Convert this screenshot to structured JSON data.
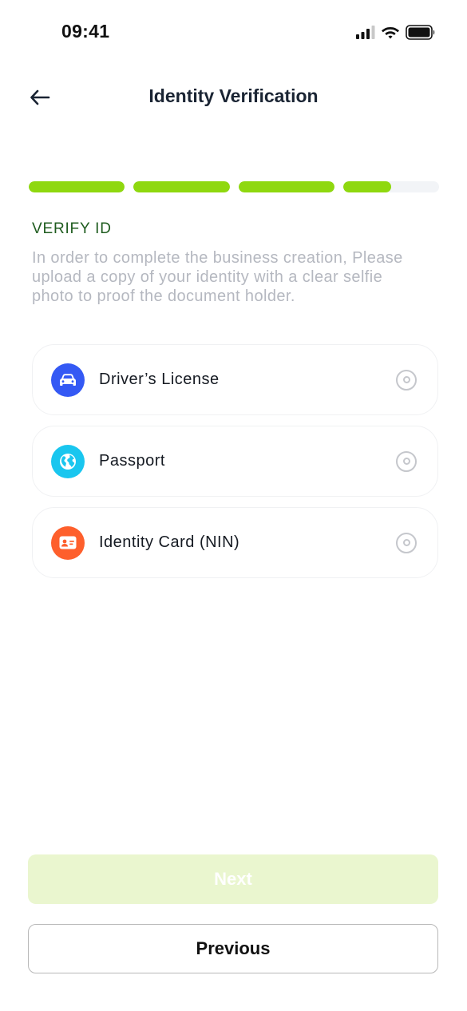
{
  "status_bar": {
    "time": "09:41",
    "icons": [
      "signal-icon",
      "wifi-icon",
      "battery-icon"
    ]
  },
  "header": {
    "back_icon": "arrow-left-icon",
    "title": "Identity Verification"
  },
  "progress": {
    "accent_color": "#8fd80f",
    "track_color": "#f2f4f7",
    "steps": [
      {
        "fill": 1.0
      },
      {
        "fill": 1.0
      },
      {
        "fill": 1.0
      },
      {
        "fill": 0.5
      }
    ]
  },
  "section": {
    "title": "VERIFY ID",
    "description": "In order to complete the business creation, Please upload a copy of your identity with a clear selfie photo to proof the document holder."
  },
  "options": [
    {
      "label": "Driver’s License",
      "icon": "car-icon",
      "color": "#3459f4",
      "selected": false
    },
    {
      "label": "Passport",
      "icon": "globe-icon",
      "color": "#19c6ef",
      "selected": false
    },
    {
      "label": "Identity Card (NIN)",
      "icon": "id-card-icon",
      "color": "#fe5f2c",
      "selected": false
    }
  ],
  "buttons": {
    "next_label": "Next",
    "next_disabled": true,
    "previous_label": "Previous"
  }
}
